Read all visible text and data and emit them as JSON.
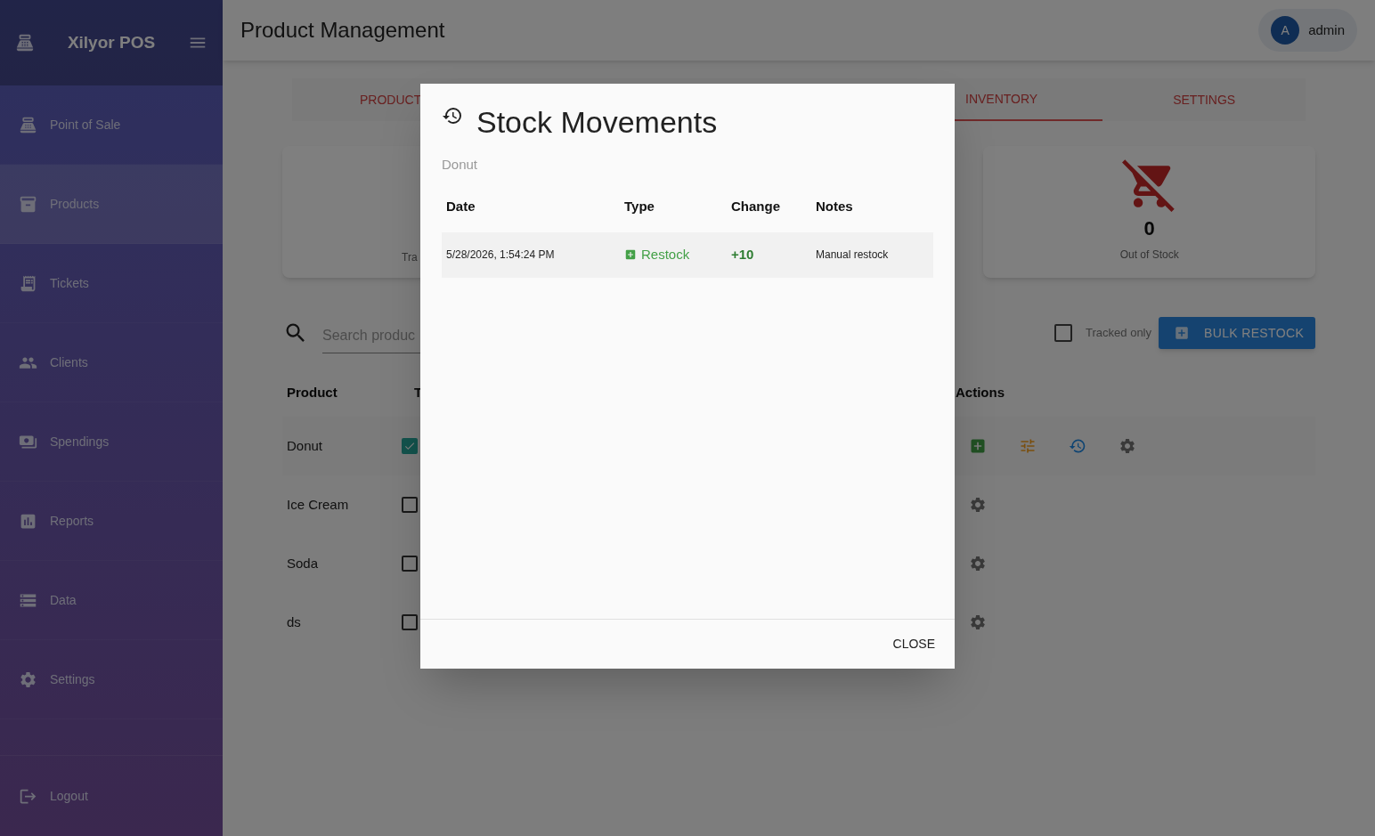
{
  "sidebar": {
    "brand": "Xilyor POS",
    "items": [
      {
        "label": "Point of Sale",
        "selected": false
      },
      {
        "label": "Products",
        "selected": true
      },
      {
        "label": "Tickets",
        "selected": false
      },
      {
        "label": "Clients",
        "selected": false
      },
      {
        "label": "Spendings",
        "selected": false
      },
      {
        "label": "Reports",
        "selected": false
      },
      {
        "label": "Data",
        "selected": false
      },
      {
        "label": "Settings",
        "selected": false
      }
    ],
    "logout": "Logout"
  },
  "header": {
    "title": "Product Management",
    "user": {
      "initial": "A",
      "name": "admin"
    }
  },
  "tabs": [
    {
      "label": "PRODUCT",
      "selected": false
    },
    {
      "label": "INVENTORY",
      "selected": true
    },
    {
      "label": "SETTINGS",
      "selected": false
    }
  ],
  "stat_cards": [
    {
      "label": "Tra"
    },
    {
      "value": "0",
      "label": "Out of Stock"
    }
  ],
  "search": {
    "placeholder": "Search produc"
  },
  "tracked_filter": {
    "label": "Tracked only",
    "checked": false
  },
  "bulk_button": "BULK RESTOCK",
  "table": {
    "columns": [
      "Product",
      "T",
      "Actions"
    ],
    "rows": [
      {
        "product": "Donut",
        "tracked": true,
        "actions": [
          {
            "kind": "restock"
          },
          {
            "kind": "adjust"
          },
          {
            "kind": "history"
          },
          {
            "kind": "settings"
          }
        ]
      },
      {
        "product": "Ice Cream",
        "tracked": false,
        "actions": [
          {
            "kind": "settings"
          }
        ]
      },
      {
        "product": "Soda",
        "tracked": false,
        "actions": [
          {
            "kind": "settings"
          }
        ]
      },
      {
        "product": "ds",
        "tracked": false,
        "actions": [
          {
            "kind": "settings"
          }
        ]
      }
    ]
  },
  "dialog": {
    "title": "Stock Movements",
    "subtitle": "Donut",
    "columns": [
      "Date",
      "Type",
      "Change",
      "Notes"
    ],
    "rows": [
      {
        "date": "5/28/2026, 1:54:24 PM",
        "type": "Restock",
        "kind": "restock",
        "change": "+10",
        "notes": "Manual restock"
      }
    ],
    "close": "CLOSE"
  }
}
